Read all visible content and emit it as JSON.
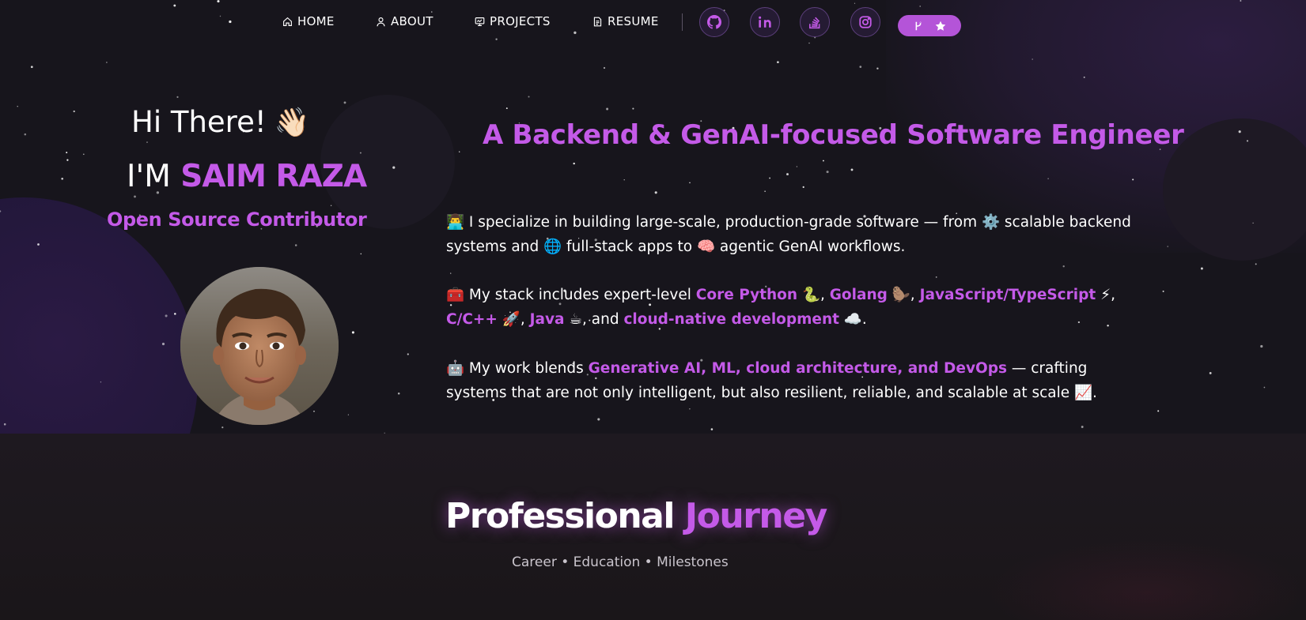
{
  "nav": {
    "items": [
      {
        "label": "HOME",
        "icon": "home-icon"
      },
      {
        "label": "ABOUT",
        "icon": "user-icon"
      },
      {
        "label": "PROJECTS",
        "icon": "projects-icon"
      },
      {
        "label": "RESUME",
        "icon": "document-icon"
      }
    ],
    "socials": [
      "github-icon",
      "linkedin-icon",
      "stackoverflow-icon",
      "instagram-icon"
    ],
    "fork_button": {
      "icons": [
        "git-fork-icon",
        "star-icon"
      ]
    }
  },
  "hero": {
    "greeting": "Hi There!",
    "greeting_emoji": "👋🏻",
    "name_prefix": "I'M ",
    "name": "SAIM RAZA",
    "role": "Open Source Contributor",
    "headline": "A Backend & GenAI-focused Software Engineer",
    "paragraphs": [
      {
        "parts": [
          {
            "t": "👨‍💻 I specialize in building large-scale, production-grade software — from ⚙️ scalable backend systems and 🌐 full-stack apps to 🧠 agentic GenAI workflows.",
            "hl": false
          }
        ]
      },
      {
        "parts": [
          {
            "t": "🧰 My stack includes expert-level ",
            "hl": false
          },
          {
            "t": "Core Python",
            "hl": true
          },
          {
            "t": " 🐍, ",
            "hl": false
          },
          {
            "t": "Golang",
            "hl": true
          },
          {
            "t": " 🦫, ",
            "hl": false
          },
          {
            "t": "JavaScript/TypeScript",
            "hl": true
          },
          {
            "t": " ⚡, ",
            "hl": false
          },
          {
            "t": "C/C++",
            "hl": true
          },
          {
            "t": " 🚀, ",
            "hl": false
          },
          {
            "t": "Java",
            "hl": true
          },
          {
            "t": " ☕, and ",
            "hl": false
          },
          {
            "t": "cloud-native development",
            "hl": true
          },
          {
            "t": " ☁️.",
            "hl": false
          }
        ]
      },
      {
        "parts": [
          {
            "t": "🤖 My work blends ",
            "hl": false
          },
          {
            "t": "Generative AI, ML, cloud architecture, and DevOps",
            "hl": true
          },
          {
            "t": " — crafting systems that are not only intelligent, but also resilient, reliable, and scalable at scale 📈.",
            "hl": false
          }
        ]
      }
    ]
  },
  "journey": {
    "title_a": "Professional",
    "title_b": "Journey",
    "subtitle": "Career • Education • Milestones"
  },
  "colors": {
    "accent": "#c45ae8",
    "background": "#17151c",
    "button": "#b454d8"
  }
}
